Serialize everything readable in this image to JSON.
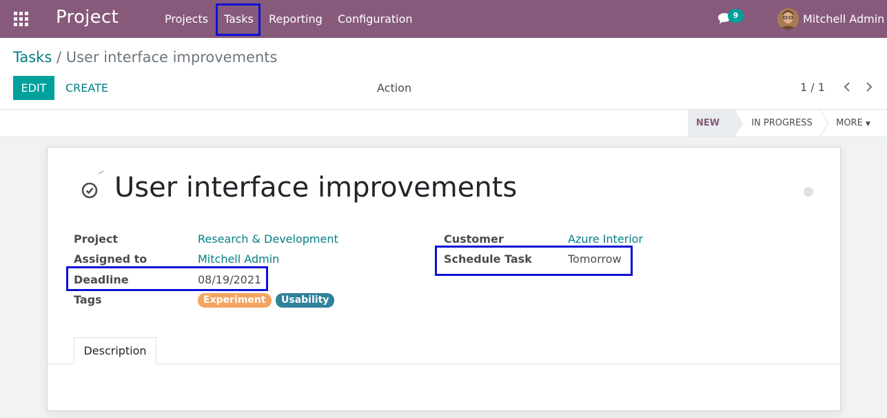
{
  "navbar": {
    "brand": "Project",
    "menu": [
      "Projects",
      "Tasks",
      "Reporting",
      "Configuration"
    ],
    "messages_count": "9",
    "user_name": "Mitchell Admin",
    "bg_color": "#875a7b"
  },
  "control_panel": {
    "breadcrumb_parent": "Tasks",
    "breadcrumb_separator": "/",
    "breadcrumb_current": "User interface improvements",
    "edit_label": "EDIT",
    "create_label": "CREATE",
    "action_label": "Action",
    "pager": "1 / 1"
  },
  "statusbar": {
    "stages": [
      "NEW",
      "IN PROGRESS"
    ],
    "more_label": "MORE",
    "active_stage": "NEW"
  },
  "task": {
    "title": "User interface improvements",
    "fields_left": [
      {
        "label": "Project",
        "value": "Research & Development"
      },
      {
        "label": "Assigned to",
        "value": "Mitchell Admin"
      },
      {
        "label": "Deadline",
        "value": "08/19/2021"
      },
      {
        "label": "Tags",
        "value": ""
      }
    ],
    "fields_right": [
      {
        "label": "Customer",
        "value": "Azure Interior"
      },
      {
        "label": "Schedule Task",
        "value": "Tomorrow"
      }
    ],
    "tags": [
      {
        "name": "Experiment",
        "color": "#f4a460"
      },
      {
        "name": "Usability",
        "color": "#30819c"
      }
    ]
  },
  "tabs": [
    "Description"
  ],
  "colors": {
    "accent": "#00a09d",
    "link": "#017e84",
    "highlight": "#0d10d6"
  }
}
